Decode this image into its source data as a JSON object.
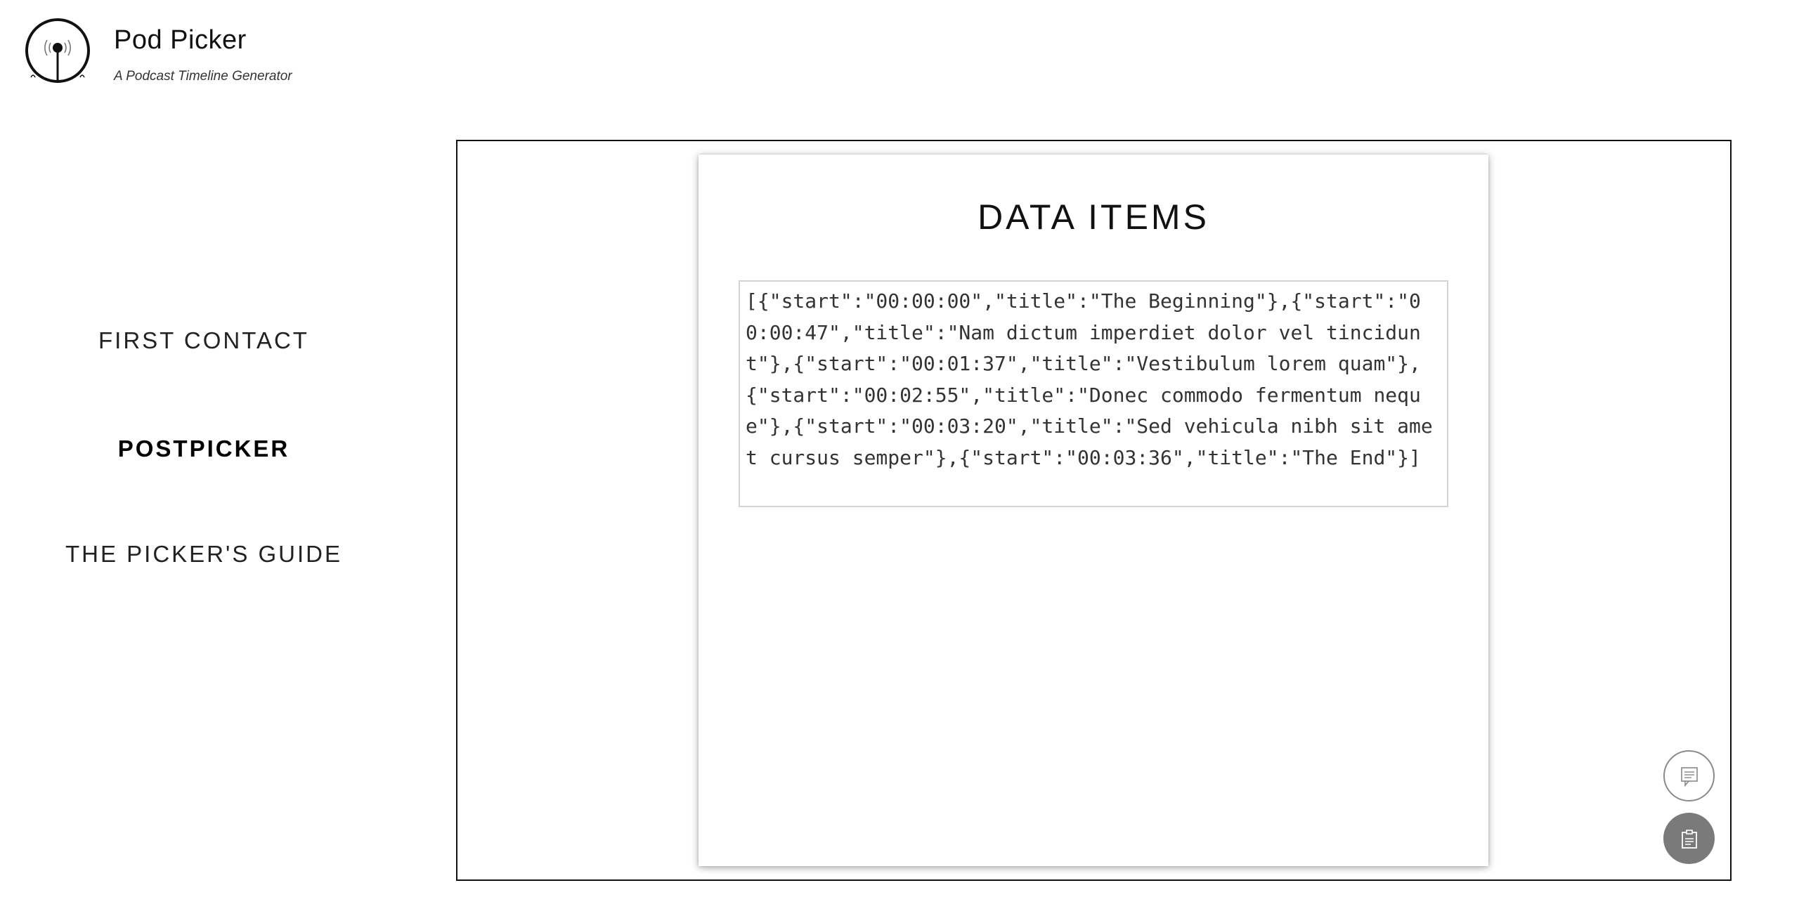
{
  "header": {
    "title": "Pod Picker",
    "subtitle": "A Podcast Timeline Generator",
    "logo_icon": "podcast-antenna-icon"
  },
  "sidebar": {
    "items": [
      {
        "label": "FIRST CONTACT",
        "active": false
      },
      {
        "label": "POSTPICKER",
        "active": true
      },
      {
        "label": "THE PICKER'S GUIDE",
        "active": false
      }
    ]
  },
  "card": {
    "title": "DATA ITEMS",
    "data_text": "[{\"start\":\"00:00:00\",\"title\":\"The Beginning\"},{\"start\":\"00:00:47\",\"title\":\"Nam dictum imperdiet dolor vel tincidunt\"},{\"start\":\"00:01:37\",\"title\":\"Vestibulum lorem quam\"},{\"start\":\"00:02:55\",\"title\":\"Donec commodo fermentum neque\"},{\"start\":\"00:03:20\",\"title\":\"Sed vehicula nibh sit amet cursus semper\"},{\"start\":\"00:03:36\",\"title\":\"The End\"}]"
  },
  "actions": {
    "secondary_icon": "document-comment-icon",
    "primary_icon": "clipboard-icon"
  },
  "colors": {
    "frame_border": "#111111",
    "fab_filled": "#7a7a7a",
    "fab_outline": "#8a8a8a",
    "textarea_border": "#d4d4d4"
  }
}
